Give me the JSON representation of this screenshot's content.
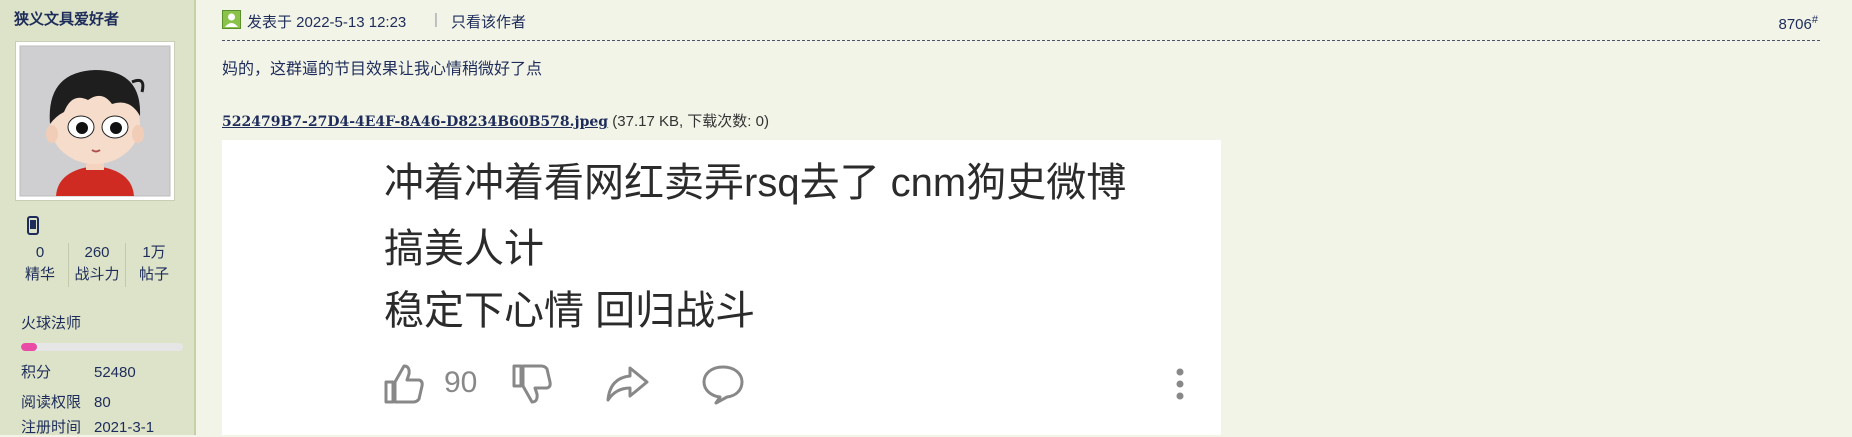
{
  "user": {
    "name": "狭义文具爱好者",
    "stats": [
      {
        "value": "0",
        "label": "精华"
      },
      {
        "value": "260",
        "label": "战斗力"
      },
      {
        "value": "1万",
        "label": "帖子"
      }
    ],
    "rank_title": "火球法师",
    "rank_progress": 0.1,
    "info": [
      {
        "key": "积分",
        "value": "52480"
      },
      {
        "key": "阅读权限",
        "value": "80"
      },
      {
        "key": "注册时间",
        "value": "2021-3-1"
      }
    ]
  },
  "post": {
    "meta": "发表于 2022-5-13 12:23",
    "separator": "|",
    "author_only": "只看该作者",
    "floor": "8706",
    "floor_mark": "#",
    "text": "妈的，这群逼的节目效果让我心情稍微好了点",
    "attachment": {
      "filename": "522479B7-27D4-4E4F-8A46-D8234B60B578.jpeg",
      "details": "(37.17 KB, 下载次数: 0)"
    }
  },
  "embedded": {
    "lines": [
      "冲着冲着看网红卖弄rsq去了 cnm狗史微博",
      "搞美人计",
      "稳定下心情 回归战斗"
    ],
    "like_count": "90",
    "icons": [
      "thumbs-up-icon",
      "thumbs-down-icon",
      "share-icon",
      "comment-icon",
      "more-icon"
    ]
  },
  "colors": {
    "page_bg": "#f3f4e8",
    "sidebar_bg": "#dde3c8",
    "text": "#1d2c5a",
    "rank_bar": "#e94aa6"
  }
}
